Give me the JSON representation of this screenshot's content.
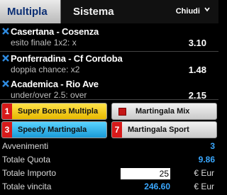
{
  "tabs": {
    "active": "Multipla",
    "inactive": "Sistema",
    "close": "Chiudi"
  },
  "bets": [
    {
      "match": "Casertana - Cosenza",
      "market": "esito finale 1x2: x",
      "odds": "3.10"
    },
    {
      "match": "Ponferradina - Cf Cordoba",
      "market": "doppia chance: x2",
      "odds": "1.48"
    },
    {
      "match": "Academica - Rio Ave",
      "market": "under/over 2.5: over",
      "odds": "2.15"
    }
  ],
  "promos": [
    {
      "badge": "1",
      "label": "Super Bonus Multipla"
    },
    {
      "badge": "",
      "label": "Martingala Mix"
    },
    {
      "badge": "3",
      "label": "Speedy Martingala"
    },
    {
      "badge": "7",
      "label": "Martingala Sport"
    }
  ],
  "summary": {
    "events_label": "Avvenimenti",
    "events": "3",
    "total_odds_label": "Totale Quota",
    "total_odds": "9.86",
    "stake_label": "Totale Importo",
    "stake": "25",
    "currency": "€ Eur",
    "win_label": "Totale vincita",
    "win": "246.60",
    "win_currency": "€ Eur"
  },
  "colors": {
    "accent": "#3aa8ff",
    "badge": "#d71a1a",
    "cross": "#2f8be0"
  }
}
